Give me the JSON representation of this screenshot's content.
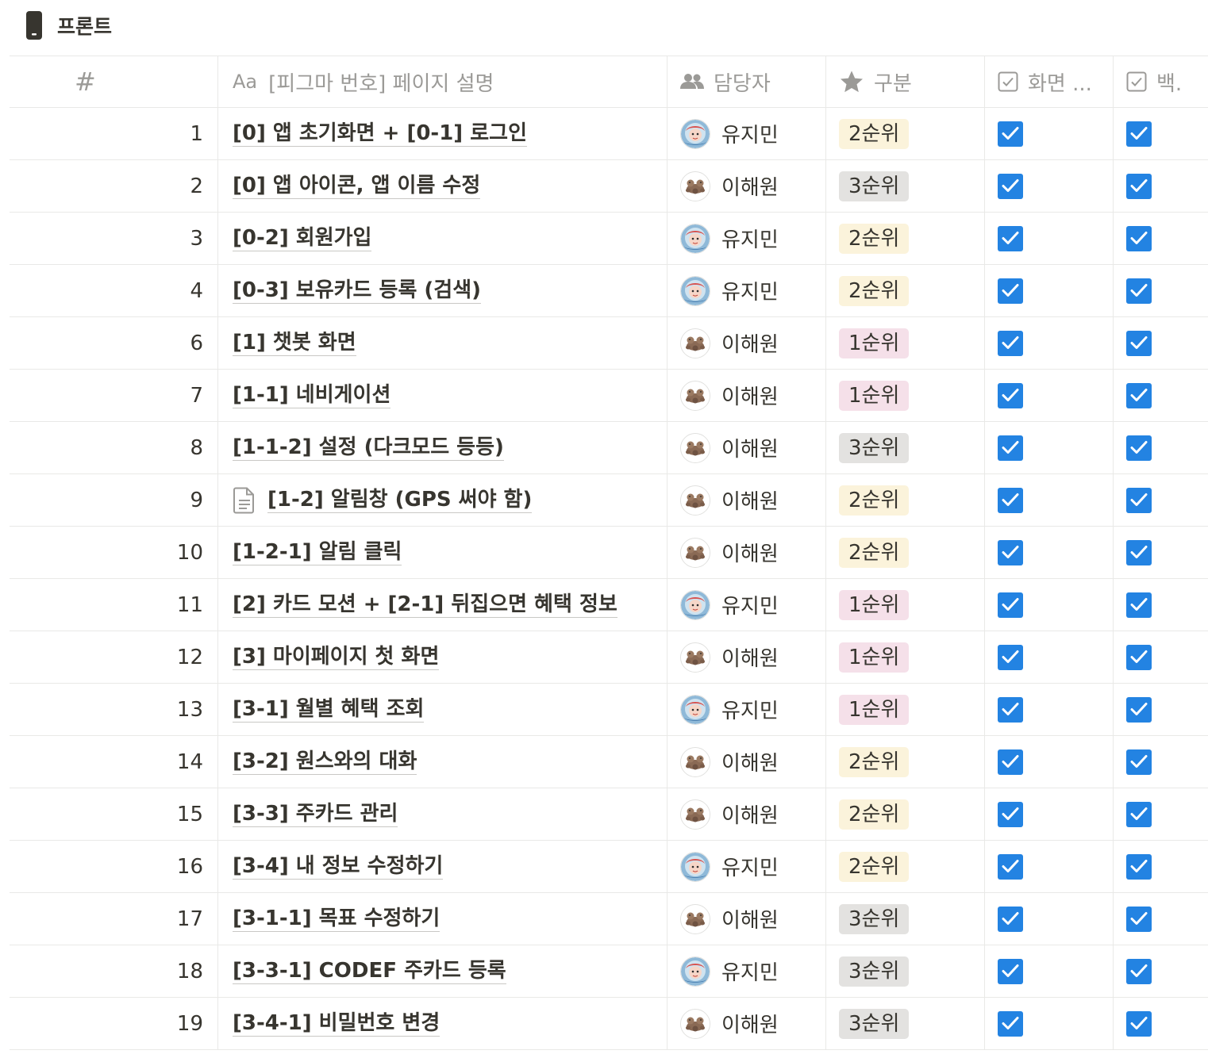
{
  "database": {
    "title": "프론트",
    "icon": "phone-icon"
  },
  "columns": {
    "number": "#",
    "name_prefix": "Aa",
    "name": "[피그마 번호] 페이지 설명",
    "owner": "담당자",
    "priority": "구분",
    "screen": "화면 ...",
    "backend": "백."
  },
  "colors": {
    "checkbox": "#2383e2",
    "tag_1": "#f5e0e9",
    "tag_2": "#fbf3db",
    "tag_3": "#e3e2e0"
  },
  "rows": [
    {
      "num": "1",
      "title": "[0] 앱 초기화면 + [0-1] 로그인",
      "has_page_icon": false,
      "owner": "유지민",
      "avatar": "ponyo-avatar-icon",
      "priority": "2순위",
      "tag_level": 2,
      "screen": true,
      "backend": true
    },
    {
      "num": "2",
      "title": "[0] 앱 아이콘, 앱 이름 수정",
      "has_page_icon": false,
      "owner": "이해원",
      "avatar": "dogs-avatar-icon",
      "priority": "3순위",
      "tag_level": 3,
      "screen": true,
      "backend": true
    },
    {
      "num": "3",
      "title": "[0-2] 회원가입",
      "has_page_icon": false,
      "owner": "유지민",
      "avatar": "ponyo-avatar-icon",
      "priority": "2순위",
      "tag_level": 2,
      "screen": true,
      "backend": true
    },
    {
      "num": "4",
      "title": "[0-3] 보유카드 등록 (검색)",
      "has_page_icon": false,
      "owner": "유지민",
      "avatar": "ponyo-avatar-icon",
      "priority": "2순위",
      "tag_level": 2,
      "screen": true,
      "backend": true
    },
    {
      "num": "6",
      "title": "[1] 챗봇 화면",
      "has_page_icon": false,
      "owner": "이해원",
      "avatar": "dogs-avatar-icon",
      "priority": "1순위",
      "tag_level": 1,
      "screen": true,
      "backend": true
    },
    {
      "num": "7",
      "title": "[1-1] 네비게이션",
      "has_page_icon": false,
      "owner": "이해원",
      "avatar": "dogs-avatar-icon",
      "priority": "1순위",
      "tag_level": 1,
      "screen": true,
      "backend": true
    },
    {
      "num": "8",
      "title": "[1-1-2] 설정 (다크모드 등등)",
      "has_page_icon": false,
      "owner": "이해원",
      "avatar": "dogs-avatar-icon",
      "priority": "3순위",
      "tag_level": 3,
      "screen": true,
      "backend": true
    },
    {
      "num": "9",
      "title": "[1-2] 알림창 (GPS 써야 함)",
      "has_page_icon": true,
      "owner": "이해원",
      "avatar": "dogs-avatar-icon",
      "priority": "2순위",
      "tag_level": 2,
      "screen": true,
      "backend": true
    },
    {
      "num": "10",
      "title": "[1-2-1] 알림 클릭",
      "has_page_icon": false,
      "owner": "이해원",
      "avatar": "dogs-avatar-icon",
      "priority": "2순위",
      "tag_level": 2,
      "screen": true,
      "backend": true
    },
    {
      "num": "11",
      "title": "[2] 카드 모션 + [2-1] 뒤집으면 혜택 정보",
      "has_page_icon": false,
      "owner": "유지민",
      "avatar": "ponyo-avatar-icon",
      "priority": "1순위",
      "tag_level": 1,
      "screen": true,
      "backend": true
    },
    {
      "num": "12",
      "title": "[3] 마이페이지 첫 화면",
      "has_page_icon": false,
      "owner": "이해원",
      "avatar": "dogs-avatar-icon",
      "priority": "1순위",
      "tag_level": 1,
      "screen": true,
      "backend": true
    },
    {
      "num": "13",
      "title": "[3-1] 월별 혜택 조회",
      "has_page_icon": false,
      "owner": "유지민",
      "avatar": "ponyo-avatar-icon",
      "priority": "1순위",
      "tag_level": 1,
      "screen": true,
      "backend": true
    },
    {
      "num": "14",
      "title": "[3-2] 원스와의 대화",
      "has_page_icon": false,
      "owner": "이해원",
      "avatar": "dogs-avatar-icon",
      "priority": "2순위",
      "tag_level": 2,
      "screen": true,
      "backend": true
    },
    {
      "num": "15",
      "title": "[3-3] 주카드 관리",
      "has_page_icon": false,
      "owner": "이해원",
      "avatar": "dogs-avatar-icon",
      "priority": "2순위",
      "tag_level": 2,
      "screen": true,
      "backend": true
    },
    {
      "num": "16",
      "title": "[3-4] 내 정보 수정하기",
      "has_page_icon": false,
      "owner": "유지민",
      "avatar": "ponyo-avatar-icon",
      "priority": "2순위",
      "tag_level": 2,
      "screen": true,
      "backend": true
    },
    {
      "num": "17",
      "title": "[3-1-1] 목표 수정하기",
      "has_page_icon": false,
      "owner": "이해원",
      "avatar": "dogs-avatar-icon",
      "priority": "3순위",
      "tag_level": 3,
      "screen": true,
      "backend": true
    },
    {
      "num": "18",
      "title": "[3-3-1] CODEF 주카드 등록",
      "has_page_icon": false,
      "owner": "유지민",
      "avatar": "ponyo-avatar-icon",
      "priority": "3순위",
      "tag_level": 3,
      "screen": true,
      "backend": true
    },
    {
      "num": "19",
      "title": "[3-4-1] 비밀번호 변경",
      "has_page_icon": false,
      "owner": "이해원",
      "avatar": "dogs-avatar-icon",
      "priority": "3순위",
      "tag_level": 3,
      "screen": true,
      "backend": true
    }
  ]
}
